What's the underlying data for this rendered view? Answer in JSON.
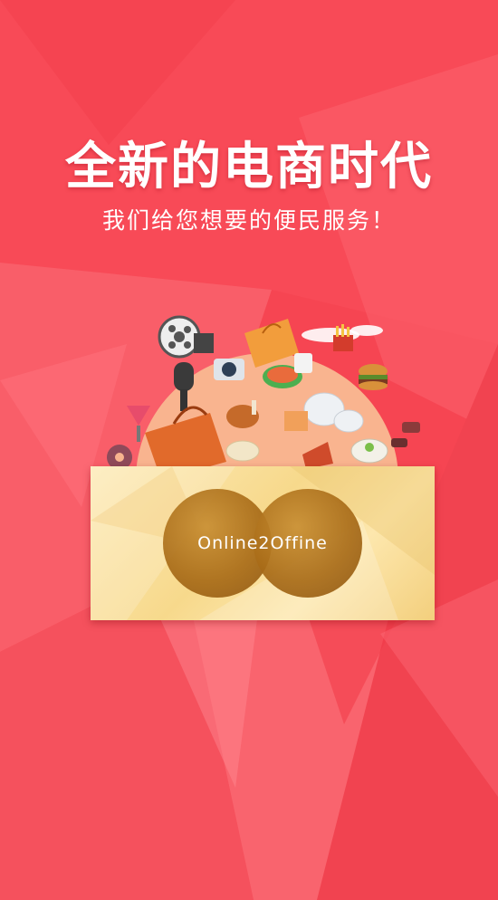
{
  "splash": {
    "headline": "全新的电商时代",
    "subtitle": "我们给您想要的便民服务！",
    "brand_text": "Online2Offine"
  },
  "colors": {
    "background": "#f64552",
    "text": "#ffffff",
    "envelope": "#f7d98c",
    "circle": "#a96c18"
  }
}
